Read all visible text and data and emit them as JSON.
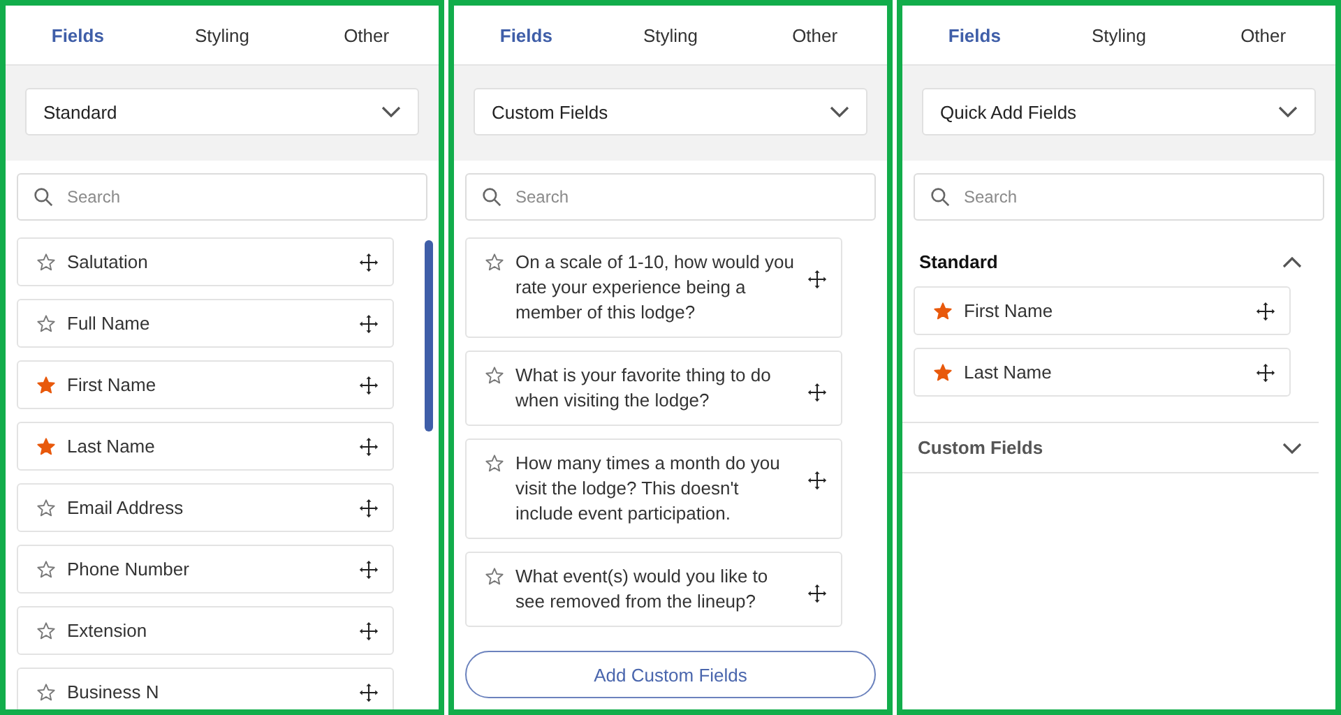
{
  "panels": [
    {
      "kind": "list",
      "tabs": [
        {
          "label": "Fields",
          "selected": true
        },
        {
          "label": "Styling",
          "selected": false
        },
        {
          "label": "Other",
          "selected": false
        }
      ],
      "dropdown": {
        "value": "Standard"
      },
      "search": {
        "placeholder": "Search"
      },
      "scrollbar": true,
      "fields": [
        {
          "label": "Salutation",
          "required": false
        },
        {
          "label": "Full Name",
          "required": false
        },
        {
          "label": "First Name",
          "required": true
        },
        {
          "label": "Last Name",
          "required": true
        },
        {
          "label": "Email Address",
          "required": false
        },
        {
          "label": "Phone Number",
          "required": false
        },
        {
          "label": "Extension",
          "required": false
        },
        {
          "label": "Business N",
          "required": false
        }
      ]
    },
    {
      "kind": "list",
      "tabs": [
        {
          "label": "Fields",
          "selected": true
        },
        {
          "label": "Styling",
          "selected": false
        },
        {
          "label": "Other",
          "selected": false
        }
      ],
      "dropdown": {
        "value": "Custom Fields"
      },
      "search": {
        "placeholder": "Search"
      },
      "scrollbar": false,
      "fields": [
        {
          "label": "On a scale of 1-10, how would you rate your experience being a member of this lodge?",
          "required": false
        },
        {
          "label": "What is your favorite thing to do when visiting the lodge?",
          "required": false
        },
        {
          "label": "How many times a month do you visit the lodge? This doesn't include event participation.",
          "required": false
        },
        {
          "label": "What event(s) would you like to see removed from the lineup?",
          "required": false
        }
      ],
      "button": "Add Custom Fields"
    },
    {
      "kind": "sections",
      "tabs": [
        {
          "label": "Fields",
          "selected": true
        },
        {
          "label": "Styling",
          "selected": false
        },
        {
          "label": "Other",
          "selected": false
        }
      ],
      "dropdown": {
        "value": "Quick Add Fields"
      },
      "search": {
        "placeholder": "Search"
      },
      "scrollbar": false,
      "sections": [
        {
          "title": "Standard",
          "expanded": true,
          "fields": [
            {
              "label": "First Name",
              "required": true
            },
            {
              "label": "Last Name",
              "required": true
            }
          ]
        },
        {
          "title": "Custom Fields",
          "expanded": false
        }
      ]
    }
  ]
}
